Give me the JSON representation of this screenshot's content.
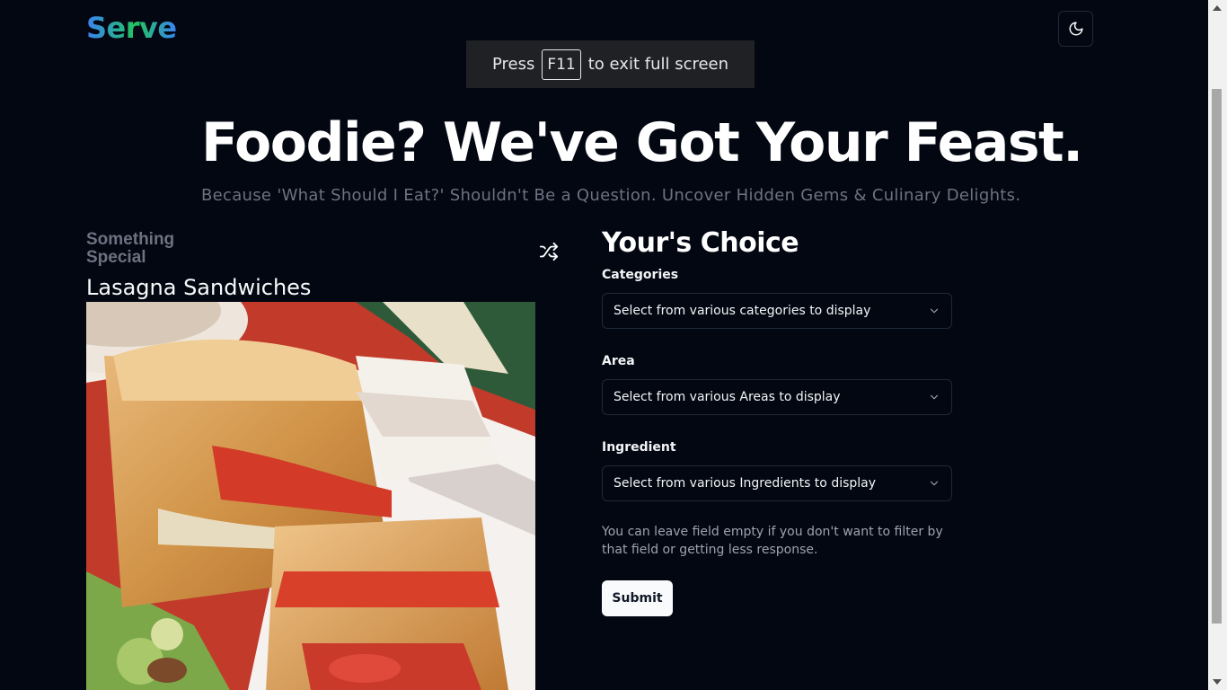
{
  "header": {
    "logo": "Serve",
    "theme_toggle_icon": "moon-icon"
  },
  "fullscreen_toast": {
    "before": "Press",
    "key": "F11",
    "after": "to exit full screen"
  },
  "hero": {
    "title": "Foodie? We've Got Your Feast.",
    "subtitle": "Because 'What Should I Eat?' Shouldn't Be a Question. Uncover Hidden Gems & Culinary Delights."
  },
  "special": {
    "heading": "Something Special",
    "shuffle_icon": "shuffle-icon",
    "meal_name": "Lasagna Sandwiches",
    "image_alt": "photo of grilled lasagna sandwiches"
  },
  "choice": {
    "title": "Your's Choice",
    "fields": [
      {
        "label": "Categories",
        "placeholder": "Select from various categories to display"
      },
      {
        "label": "Area",
        "placeholder": "Select from various Areas to display"
      },
      {
        "label": "Ingredient",
        "placeholder": "Select from various Ingredients to display"
      }
    ],
    "hint": "You can leave field empty if you don't want to filter by that field or getting less response.",
    "submit_label": "Submit"
  },
  "colors": {
    "background": "#030712",
    "logo_gradient_start": "#3b82f6",
    "logo_gradient_mid": "#22c55e",
    "muted_text": "#6b7280",
    "button_bg": "#f9fafb"
  }
}
